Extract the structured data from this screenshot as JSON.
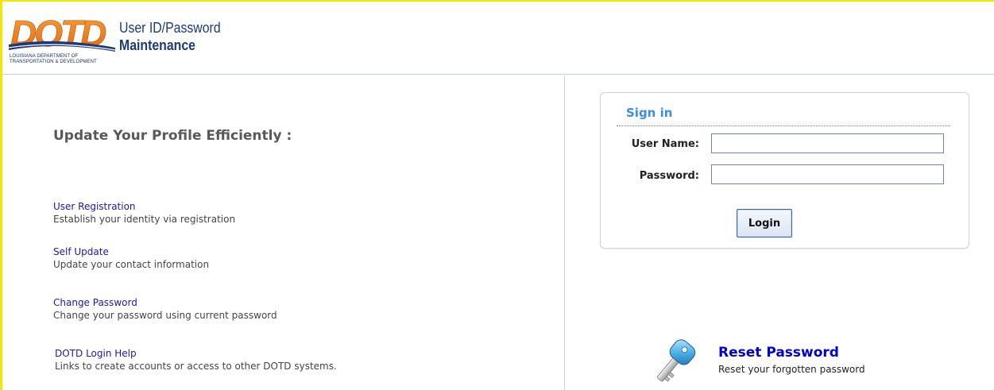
{
  "header": {
    "logo_text": "DOTD",
    "logo_subtitle_line1": "LOUISIANA DEPARTMENT OF",
    "logo_subtitle_line2": "TRANSPORTATION & DEVELOPMENT",
    "title_line1": "User ID/Password",
    "title_line2": "Maintenance"
  },
  "left": {
    "heading": "Update Your Profile Efficiently :",
    "links": [
      {
        "label": "User Registration",
        "description": "Establish your identity via registration"
      },
      {
        "label": "Self Update",
        "description": "Update your contact information"
      },
      {
        "label": "Change Password",
        "description": "Change your password using current password"
      },
      {
        "label": "DOTD Login Help",
        "description": "Links to create accounts or access to other DOTD systems."
      }
    ]
  },
  "signin": {
    "title": "Sign in",
    "username_label": "User Name:",
    "username_value": "",
    "password_label": "Password:",
    "password_value": "",
    "login_label": "Login"
  },
  "reset": {
    "title": "Reset Password",
    "description": "Reset your forgotten password",
    "icon": "key-icon"
  },
  "colors": {
    "frame": "#f3e600",
    "logo_orange": "#f07a1c",
    "logo_blue": "#1c3a7a",
    "link": "#1a1aa6",
    "signin_title": "#3c8fdc",
    "reset_title": "#0000cc"
  }
}
